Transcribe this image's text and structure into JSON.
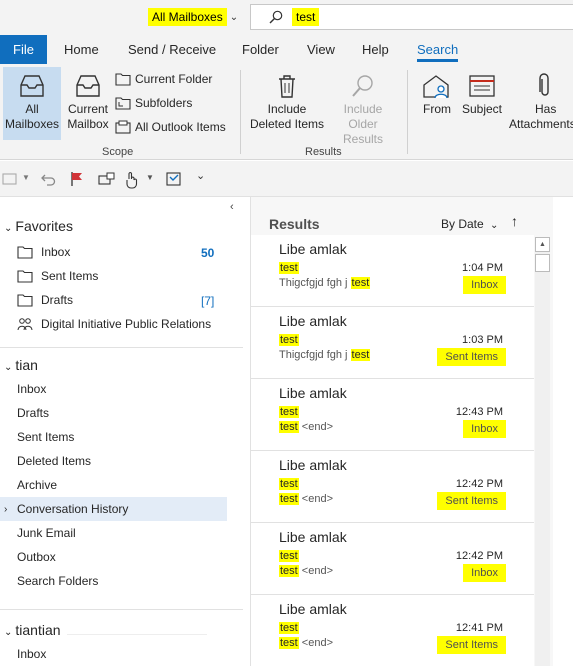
{
  "search": {
    "scope_label": "All Mailboxes",
    "query": "test"
  },
  "tabs": [
    "File",
    "Home",
    "Send / Receive",
    "Folder",
    "View",
    "Help",
    "Search"
  ],
  "ribbon": {
    "scope": {
      "all_mailboxes": [
        "All",
        "Mailboxes"
      ],
      "current_mailbox": [
        "Current",
        "Mailbox"
      ],
      "current_folder": "Current Folder",
      "subfolders": "Subfolders",
      "all_outlook_items": "All Outlook Items",
      "group_label": "Scope"
    },
    "results": {
      "include_deleted": [
        "Include",
        "Deleted Items"
      ],
      "include_older": [
        "Include",
        "Older Results"
      ],
      "group_label": "Results"
    },
    "refine": {
      "from": "From",
      "subject": "Subject",
      "has_attachments": [
        "Has",
        "Attachments"
      ]
    }
  },
  "favorites": {
    "header": "Favorites",
    "items": [
      {
        "label": "Inbox",
        "count": "50"
      },
      {
        "label": "Sent Items",
        "count": ""
      },
      {
        "label": "Drafts",
        "count": "[7]"
      },
      {
        "label": "Digital Initiative Public Relations",
        "count": ""
      }
    ]
  },
  "mailbox1": {
    "header": "tian",
    "items": [
      "Inbox",
      "Drafts",
      "Sent Items",
      "Deleted Items",
      "Archive",
      "Conversation History",
      "Junk Email",
      "Outbox",
      "Search Folders"
    ]
  },
  "mailbox2": {
    "header": "tiantian",
    "items": [
      "Inbox"
    ]
  },
  "results": {
    "title": "Results",
    "sort": "By Date",
    "messages": [
      {
        "from": "Libe amlak",
        "subject": "test",
        "preview": "Thigcfgjd fgh j",
        "preview_hl": "test",
        "time": "1:04 PM",
        "folder": "Inbox"
      },
      {
        "from": "Libe amlak",
        "subject": "test",
        "preview": "Thigcfgjd fgh j",
        "preview_hl": "test",
        "time": "1:03 PM",
        "folder": "Sent Items"
      },
      {
        "from": "Libe amlak",
        "subject": "test",
        "preview": "<end>",
        "preview_hl": "test",
        "time": "12:43 PM",
        "folder": "Inbox"
      },
      {
        "from": "Libe amlak",
        "subject": "test",
        "preview": "<end>",
        "preview_hl": "test",
        "time": "12:42 PM",
        "folder": "Sent Items"
      },
      {
        "from": "Libe amlak",
        "subject": "test",
        "preview": "<end>",
        "preview_hl": "test",
        "time": "12:42 PM",
        "folder": "Inbox"
      },
      {
        "from": "Libe amlak",
        "subject": "test",
        "preview": "<end>",
        "preview_hl": "test",
        "time": "12:41 PM",
        "folder": "Sent Items"
      }
    ]
  },
  "colors": {
    "accent": "#106ebe",
    "highlight": "#ffff00",
    "selected": "#c7dcf0"
  }
}
